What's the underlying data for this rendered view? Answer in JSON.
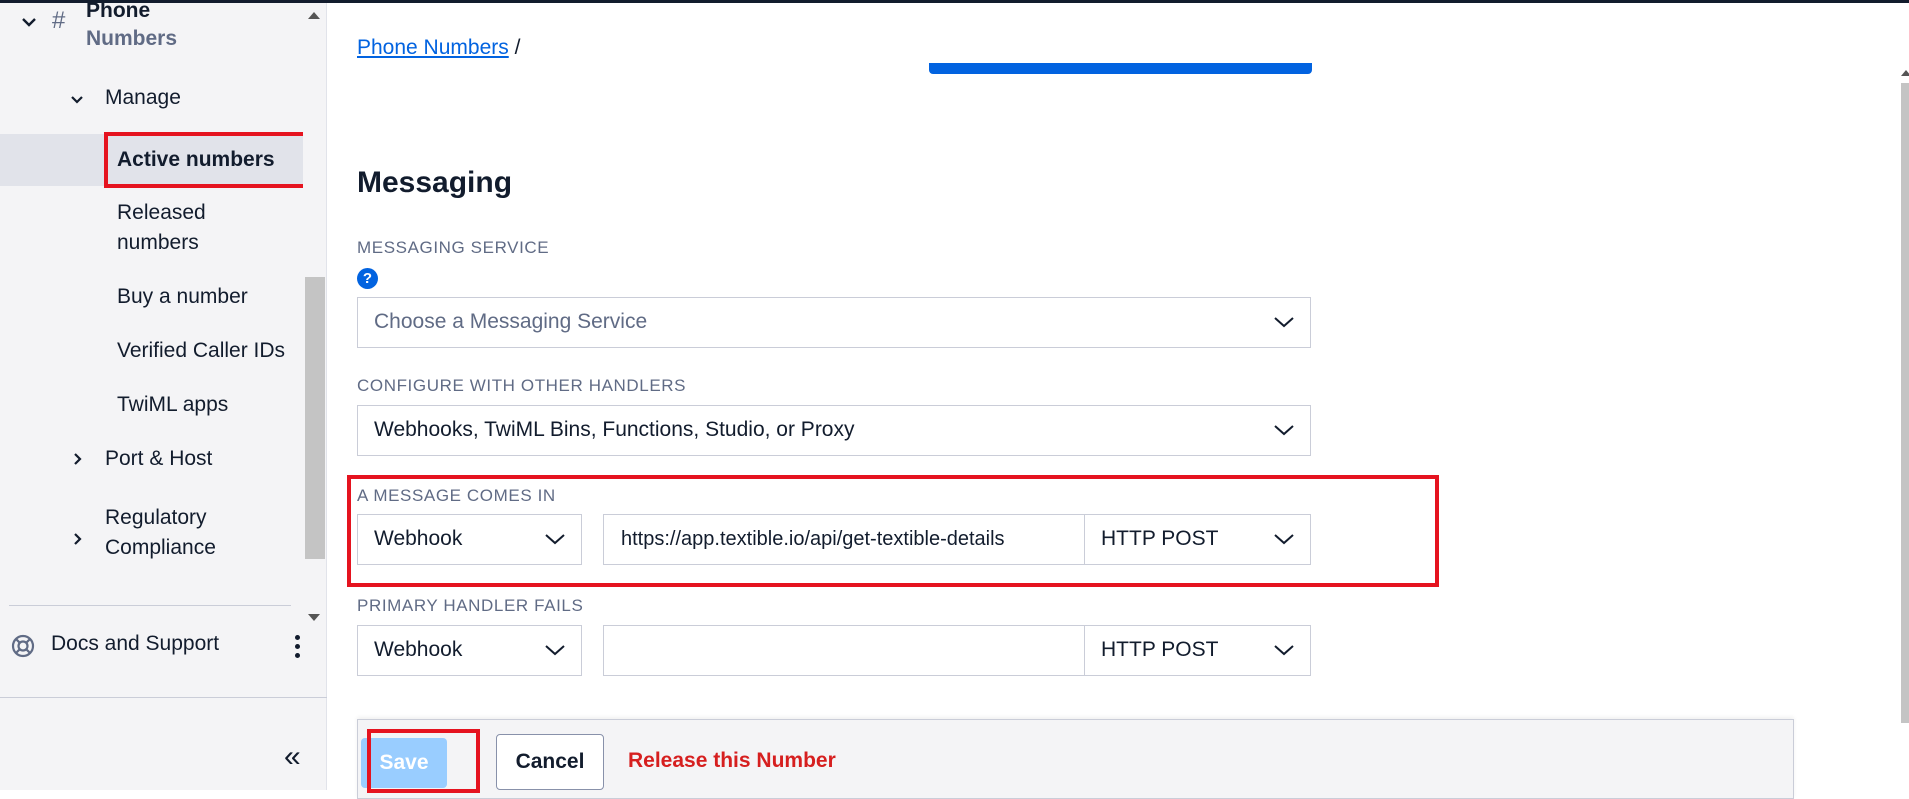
{
  "sidebar": {
    "phone_numbers_line1": "Phone",
    "phone_numbers_line2": "Numbers",
    "manage": "Manage",
    "items": {
      "active_numbers": "Active numbers",
      "released_line1": "Released",
      "released_line2": "numbers",
      "buy_number": "Buy a number",
      "verified_caller_ids": "Verified Caller IDs",
      "twiml_apps": "TwiML apps"
    },
    "port_host": "Port & Host",
    "regulatory_line1": "Regulatory",
    "regulatory_line2": "Compliance",
    "docs_support": "Docs and Support",
    "collapse_glyph": "«"
  },
  "main": {
    "breadcrumb_link": "Phone Numbers",
    "breadcrumb_sep": "/",
    "section_title": "Messaging",
    "messaging_service": {
      "label": "MESSAGING SERVICE",
      "placeholder": "Choose a Messaging Service"
    },
    "configure": {
      "label": "CONFIGURE WITH OTHER HANDLERS",
      "value": "Webhooks, TwiML Bins, Functions, Studio, or Proxy"
    },
    "message_comes_in": {
      "label": "A MESSAGE COMES IN",
      "type": "Webhook",
      "url": "https://app.textible.io/api/get-textible-details",
      "method": "HTTP POST"
    },
    "primary_handler_fails": {
      "label": "PRIMARY HANDLER FAILS",
      "type": "Webhook",
      "url": "",
      "method": "HTTP POST"
    },
    "actions": {
      "save": "Save",
      "cancel": "Cancel",
      "release": "Release this Number"
    }
  },
  "colors": {
    "link_blue": "#0263e0",
    "highlight_red": "#e5131f",
    "danger_text": "#d61f1f",
    "save_disabled": "#99cdff"
  }
}
